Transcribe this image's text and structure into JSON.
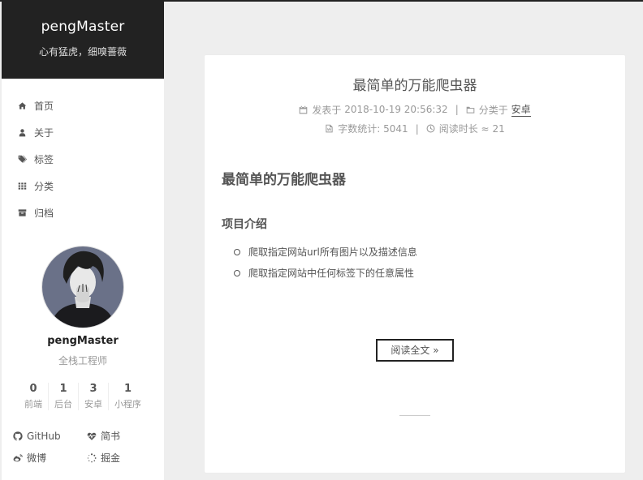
{
  "site": {
    "title": "pengMaster",
    "subtitle": "心有猛虎，细嗅蔷薇"
  },
  "menu": [
    {
      "label": "首页",
      "icon": "home-icon"
    },
    {
      "label": "关于",
      "icon": "user-icon"
    },
    {
      "label": "标签",
      "icon": "tags-icon"
    },
    {
      "label": "分类",
      "icon": "grid-icon"
    },
    {
      "label": "归档",
      "icon": "archive-icon"
    }
  ],
  "author": {
    "name": "pengMaster",
    "description": "全栈工程师"
  },
  "stats": [
    {
      "count": "0",
      "name": "前端"
    },
    {
      "count": "1",
      "name": "后台"
    },
    {
      "count": "3",
      "name": "安卓"
    },
    {
      "count": "1",
      "name": "小程序"
    }
  ],
  "links": [
    {
      "label": "GitHub",
      "icon": "github-icon"
    },
    {
      "label": "简书",
      "icon": "heartbeat-icon"
    },
    {
      "label": "微博",
      "icon": "weibo-icon"
    },
    {
      "label": "掘金",
      "icon": "spinner-icon"
    }
  ],
  "post": {
    "title": "最简单的万能爬虫器",
    "published_label": "发表于",
    "published": "2018-10-19 20:56:32",
    "category_label": "分类于",
    "category": "安卓",
    "wordcount_label": "字数统计:",
    "wordcount": "5041",
    "readtime_label": "阅读时长 ≈",
    "readtime": "21",
    "heading": "最简单的万能爬虫器",
    "subheading": "项目介绍",
    "bullets": [
      "爬取指定网站url所有图片以及描述信息",
      "爬取指定网站中任何标签下的任意属性"
    ],
    "read_more": "阅读全文 »"
  }
}
